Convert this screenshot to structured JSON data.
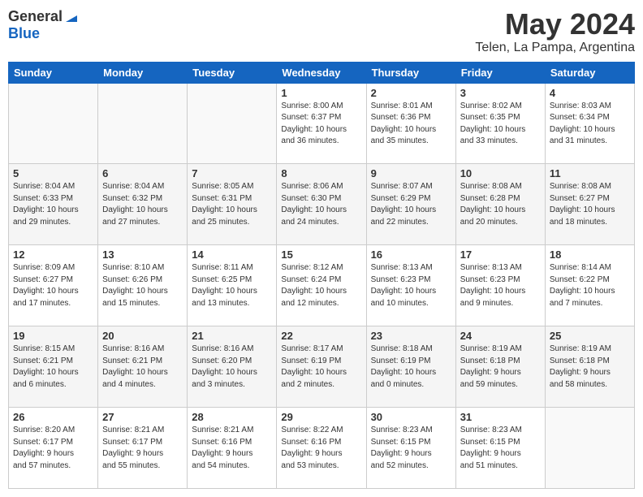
{
  "logo": {
    "general": "General",
    "blue": "Blue"
  },
  "title": "May 2024",
  "location": "Telen, La Pampa, Argentina",
  "days_header": [
    "Sunday",
    "Monday",
    "Tuesday",
    "Wednesday",
    "Thursday",
    "Friday",
    "Saturday"
  ],
  "weeks": [
    [
      {
        "day": "",
        "info": ""
      },
      {
        "day": "",
        "info": ""
      },
      {
        "day": "",
        "info": ""
      },
      {
        "day": "1",
        "info": "Sunrise: 8:00 AM\nSunset: 6:37 PM\nDaylight: 10 hours\nand 36 minutes."
      },
      {
        "day": "2",
        "info": "Sunrise: 8:01 AM\nSunset: 6:36 PM\nDaylight: 10 hours\nand 35 minutes."
      },
      {
        "day": "3",
        "info": "Sunrise: 8:02 AM\nSunset: 6:35 PM\nDaylight: 10 hours\nand 33 minutes."
      },
      {
        "day": "4",
        "info": "Sunrise: 8:03 AM\nSunset: 6:34 PM\nDaylight: 10 hours\nand 31 minutes."
      }
    ],
    [
      {
        "day": "5",
        "info": "Sunrise: 8:04 AM\nSunset: 6:33 PM\nDaylight: 10 hours\nand 29 minutes."
      },
      {
        "day": "6",
        "info": "Sunrise: 8:04 AM\nSunset: 6:32 PM\nDaylight: 10 hours\nand 27 minutes."
      },
      {
        "day": "7",
        "info": "Sunrise: 8:05 AM\nSunset: 6:31 PM\nDaylight: 10 hours\nand 25 minutes."
      },
      {
        "day": "8",
        "info": "Sunrise: 8:06 AM\nSunset: 6:30 PM\nDaylight: 10 hours\nand 24 minutes."
      },
      {
        "day": "9",
        "info": "Sunrise: 8:07 AM\nSunset: 6:29 PM\nDaylight: 10 hours\nand 22 minutes."
      },
      {
        "day": "10",
        "info": "Sunrise: 8:08 AM\nSunset: 6:28 PM\nDaylight: 10 hours\nand 20 minutes."
      },
      {
        "day": "11",
        "info": "Sunrise: 8:08 AM\nSunset: 6:27 PM\nDaylight: 10 hours\nand 18 minutes."
      }
    ],
    [
      {
        "day": "12",
        "info": "Sunrise: 8:09 AM\nSunset: 6:27 PM\nDaylight: 10 hours\nand 17 minutes."
      },
      {
        "day": "13",
        "info": "Sunrise: 8:10 AM\nSunset: 6:26 PM\nDaylight: 10 hours\nand 15 minutes."
      },
      {
        "day": "14",
        "info": "Sunrise: 8:11 AM\nSunset: 6:25 PM\nDaylight: 10 hours\nand 13 minutes."
      },
      {
        "day": "15",
        "info": "Sunrise: 8:12 AM\nSunset: 6:24 PM\nDaylight: 10 hours\nand 12 minutes."
      },
      {
        "day": "16",
        "info": "Sunrise: 8:13 AM\nSunset: 6:23 PM\nDaylight: 10 hours\nand 10 minutes."
      },
      {
        "day": "17",
        "info": "Sunrise: 8:13 AM\nSunset: 6:23 PM\nDaylight: 10 hours\nand 9 minutes."
      },
      {
        "day": "18",
        "info": "Sunrise: 8:14 AM\nSunset: 6:22 PM\nDaylight: 10 hours\nand 7 minutes."
      }
    ],
    [
      {
        "day": "19",
        "info": "Sunrise: 8:15 AM\nSunset: 6:21 PM\nDaylight: 10 hours\nand 6 minutes."
      },
      {
        "day": "20",
        "info": "Sunrise: 8:16 AM\nSunset: 6:21 PM\nDaylight: 10 hours\nand 4 minutes."
      },
      {
        "day": "21",
        "info": "Sunrise: 8:16 AM\nSunset: 6:20 PM\nDaylight: 10 hours\nand 3 minutes."
      },
      {
        "day": "22",
        "info": "Sunrise: 8:17 AM\nSunset: 6:19 PM\nDaylight: 10 hours\nand 2 minutes."
      },
      {
        "day": "23",
        "info": "Sunrise: 8:18 AM\nSunset: 6:19 PM\nDaylight: 10 hours\nand 0 minutes."
      },
      {
        "day": "24",
        "info": "Sunrise: 8:19 AM\nSunset: 6:18 PM\nDaylight: 9 hours\nand 59 minutes."
      },
      {
        "day": "25",
        "info": "Sunrise: 8:19 AM\nSunset: 6:18 PM\nDaylight: 9 hours\nand 58 minutes."
      }
    ],
    [
      {
        "day": "26",
        "info": "Sunrise: 8:20 AM\nSunset: 6:17 PM\nDaylight: 9 hours\nand 57 minutes."
      },
      {
        "day": "27",
        "info": "Sunrise: 8:21 AM\nSunset: 6:17 PM\nDaylight: 9 hours\nand 55 minutes."
      },
      {
        "day": "28",
        "info": "Sunrise: 8:21 AM\nSunset: 6:16 PM\nDaylight: 9 hours\nand 54 minutes."
      },
      {
        "day": "29",
        "info": "Sunrise: 8:22 AM\nSunset: 6:16 PM\nDaylight: 9 hours\nand 53 minutes."
      },
      {
        "day": "30",
        "info": "Sunrise: 8:23 AM\nSunset: 6:15 PM\nDaylight: 9 hours\nand 52 minutes."
      },
      {
        "day": "31",
        "info": "Sunrise: 8:23 AM\nSunset: 6:15 PM\nDaylight: 9 hours\nand 51 minutes."
      },
      {
        "day": "",
        "info": ""
      }
    ]
  ]
}
